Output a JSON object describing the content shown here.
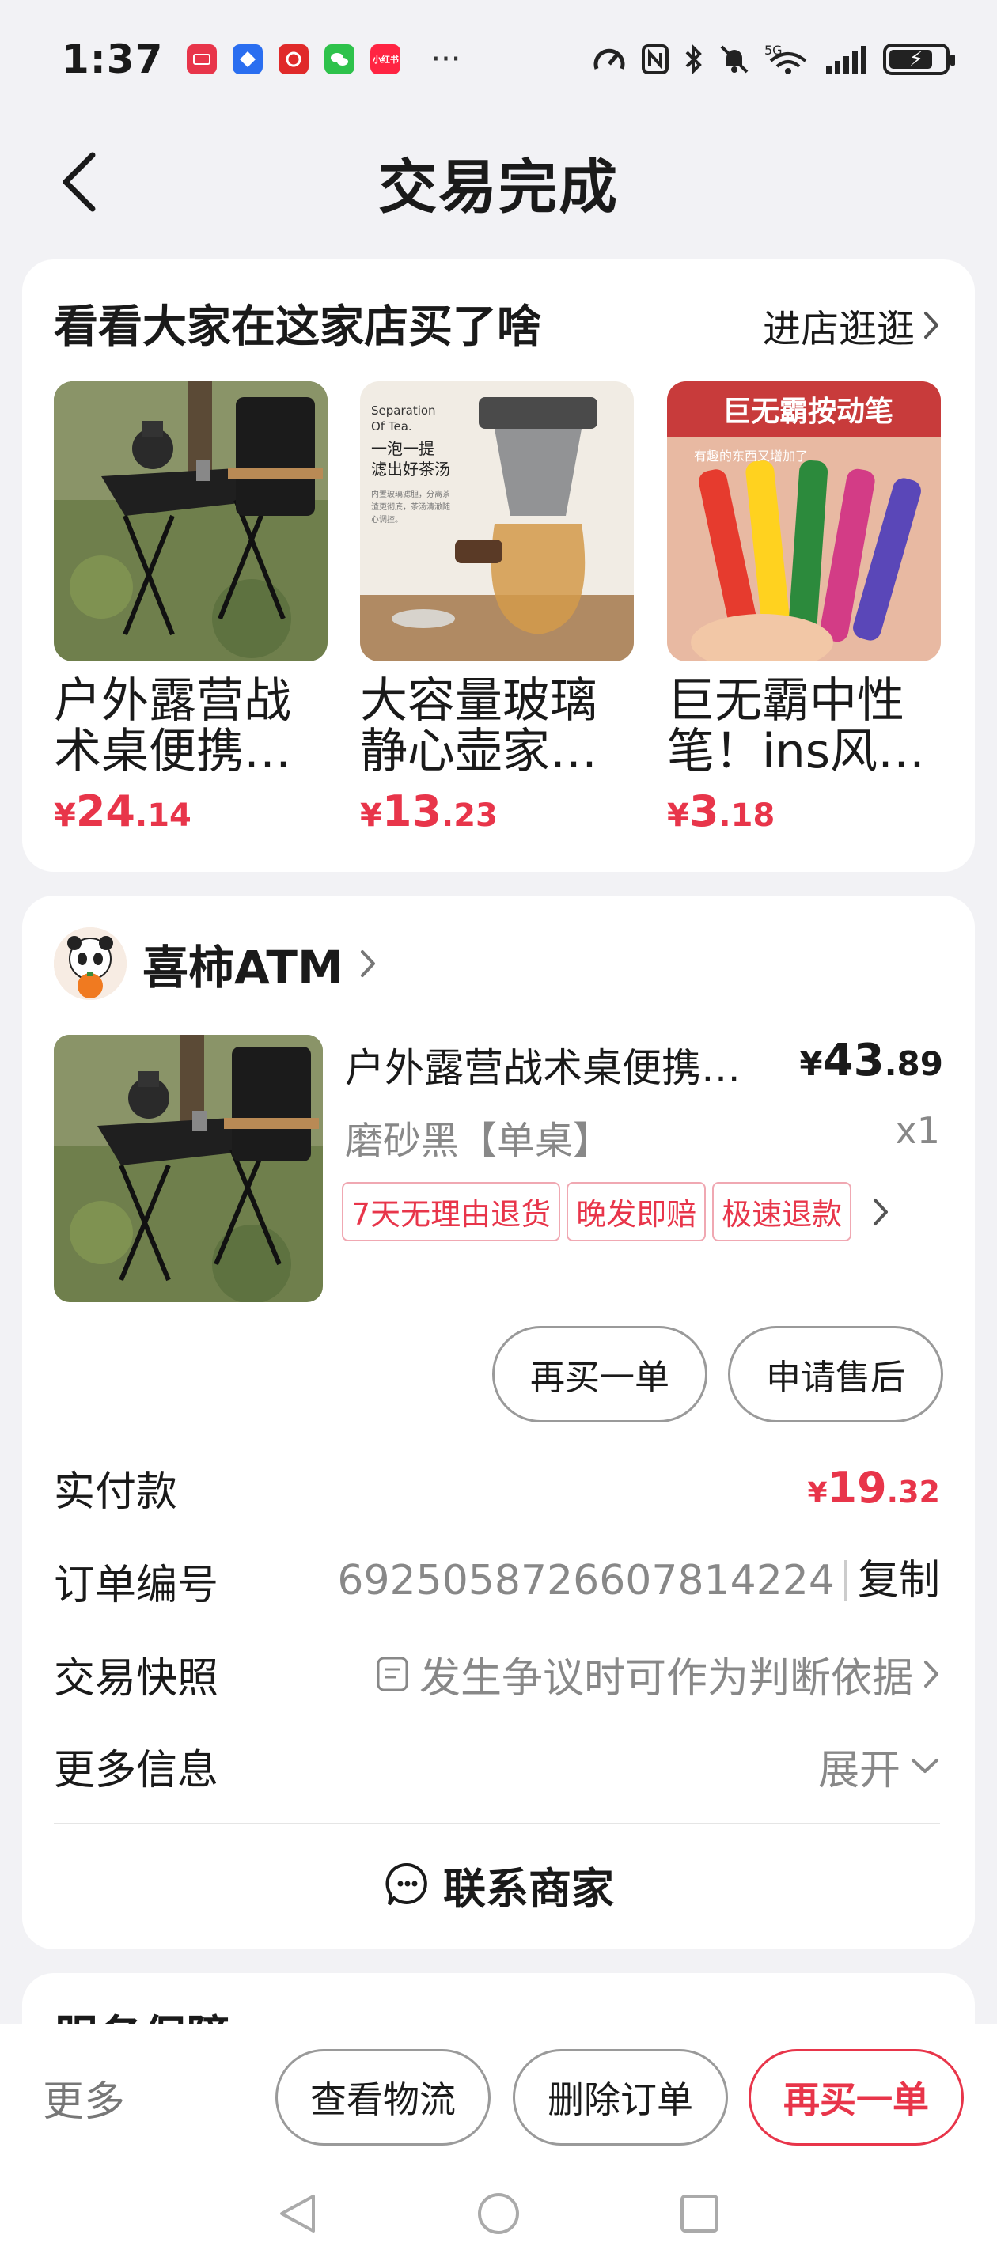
{
  "status_bar": {
    "time": "1:37",
    "apps": [
      {
        "icon": "huawei-app-icon",
        "color": "#e8354a",
        "label": ""
      },
      {
        "icon": "blue-app-icon",
        "color": "#2a6ef0",
        "label": ""
      },
      {
        "icon": "red-app-icon",
        "color": "#e02a2a",
        "label": ""
      },
      {
        "icon": "wechat-icon",
        "color": "#2ec24b",
        "label": ""
      },
      {
        "icon": "xiaohongshu-icon",
        "color": "#ff2442",
        "label": "小红书"
      }
    ],
    "more": "···",
    "network": "5G",
    "battery_level": 0.8
  },
  "nav": {
    "title": "交易完成"
  },
  "recommend": {
    "title": "看看大家在这家店买了啥",
    "link": "进店逛逛",
    "items": [
      {
        "name": "户外露营战术桌便携…",
        "price_symbol": "¥",
        "price_int": "24",
        "price_dec": ".14"
      },
      {
        "name": "大容量玻璃静心壶家…",
        "price_symbol": "¥",
        "price_int": "13",
        "price_dec": ".23",
        "image_text": [
          "Separation",
          "Of Tea.",
          "一泡一提",
          "滤出好茶汤",
          "内置玻璃滤胆，分离茶",
          "渣更彻底，茶汤清澈随",
          "心调控。"
        ]
      },
      {
        "name": "巨无霸中性笔！ins风…",
        "price_symbol": "¥",
        "price_int": "3",
        "price_dec": ".18",
        "image_text": [
          "巨无霸按动笔",
          "有趣的东西又增加了"
        ]
      }
    ]
  },
  "order": {
    "shop_name": "喜柿ATM",
    "product": {
      "name": "户外露营战术桌便携…",
      "price_symbol": "¥",
      "price_int": "43",
      "price_dec": ".89",
      "spec": "磨砂黑【单桌】",
      "qty": "x1",
      "tags": [
        "7天无理由退货",
        "晚发即赔",
        "极速退款"
      ]
    },
    "buttons": {
      "buy_again": "再买一单",
      "after_sale": "申请售后"
    },
    "rows": {
      "paid_label": "实付款",
      "paid_symbol": "¥",
      "paid_int": "19",
      "paid_dec": ".32",
      "order_no_label": "订单编号",
      "order_no": "6925058726607814224",
      "copy": "复制",
      "snapshot_label": "交易快照",
      "snapshot_value": "发生争议时可作为判断依据",
      "more_label": "更多信息",
      "more_value": "展开"
    },
    "contact": "联系商家"
  },
  "service": {
    "title": "服务保障"
  },
  "bottom": {
    "more": "更多",
    "logistics": "查看物流",
    "delete": "删除订单",
    "buy_again": "再买一单"
  },
  "colors": {
    "accent": "#e8354a",
    "page_bg": "#f2f2f5"
  }
}
